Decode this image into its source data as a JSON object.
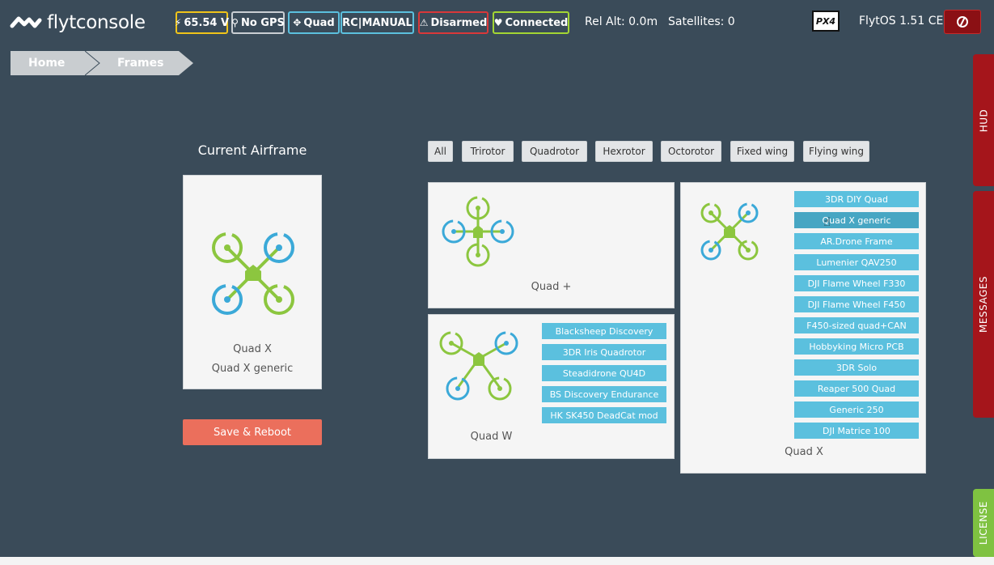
{
  "header": {
    "brand": "flytconsole",
    "badges": [
      {
        "icon": "⚡",
        "label": "65.54 V",
        "color": "#f0c419"
      },
      {
        "icon": "⚲",
        "label": "No GPS",
        "color": "#c9ced3"
      },
      {
        "icon": "✥",
        "label": "Quad",
        "color": "#5bc0de"
      },
      {
        "icon": "",
        "label": "RC|MANUAL",
        "color": "#5bc0de"
      },
      {
        "icon": "⚠",
        "label": "Disarmed",
        "color": "#d9383a"
      },
      {
        "icon": "♥",
        "label": "Connected",
        "color": "#a3d633"
      }
    ],
    "rel_alt": "Rel Alt: 0.0m",
    "satellites": "Satellites: 0",
    "px4_logo": "PX4",
    "version": "FlytOS 1.51 CE",
    "power_icon": "power-icon"
  },
  "breadcrumb": [
    "Home",
    "Frames"
  ],
  "side_tabs": [
    {
      "label": "HUD",
      "color": "#a5151b"
    },
    {
      "label": "MESSAGES",
      "color": "#a5151b"
    },
    {
      "label": "LICENSE",
      "color": "#7fc241"
    }
  ],
  "current": {
    "title": "Current Airframe",
    "type": "Quad X",
    "model": "Quad X generic",
    "save_label": "Save & Reboot"
  },
  "filters": [
    "All",
    "Trirotor",
    "Quadrotor",
    "Hexrotor",
    "Octorotor",
    "Fixed wing",
    "Flying wing"
  ],
  "frames": [
    {
      "label": "Quad +",
      "models": []
    },
    {
      "label": "Quad W",
      "models": [
        "Blacksheep Discovery",
        "3DR Iris Quadrotor",
        "Steadidrone QU4D",
        "BS Discovery Endurance",
        "HK SK450 DeadCat mod"
      ]
    },
    {
      "label": "Quad X",
      "models": [
        "3DR DIY Quad",
        "Quad X generic",
        "AR.Drone Frame",
        "Lumenier QAV250",
        "DJI Flame Wheel F330",
        "DJI Flame Wheel F450",
        "F450-sized quad+CAN",
        "Hobbyking Micro PCB",
        "3DR Solo",
        "Reaper 500 Quad",
        "Generic 250",
        "DJI Matrice 100"
      ],
      "selected": "Quad X generic"
    }
  ],
  "colors": {
    "green": "#8cc63f",
    "blue": "#3ba9d8",
    "accent_red": "#eb6f5c"
  }
}
